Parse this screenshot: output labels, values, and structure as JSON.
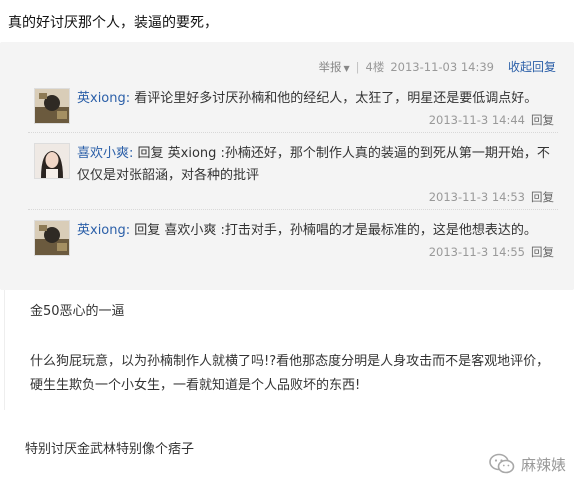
{
  "post": {
    "text": "真的好讨厌那个人，装逼的要死，"
  },
  "comment_meta": {
    "report_label": "举报",
    "floor": "4楼",
    "timestamp": "2013-11-03 14:39",
    "collapse_label": "收起回复"
  },
  "replies": [
    {
      "user": "英xiong:",
      "content": "看评论里好多讨厌孙楠和他的经纪人，太狂了，明星还是要低调点好。",
      "time": "2013-11-3 14:44",
      "reply_label": "回复",
      "avatar_icon": "avatar-dark-icon"
    },
    {
      "user": "喜欢小爽:",
      "content": "回复 英xiong :孙楠还好，那个制作人真的装逼的到死从第一期开始，不仅仅是对张韶涵，对各种的批评",
      "time": "2013-11-3 14:53",
      "reply_label": "回复",
      "avatar_icon": "avatar-girl-icon"
    },
    {
      "user": "英xiong:",
      "content": "回复 喜欢小爽 :打击对手，孙楠唱的才是最标准的，这是他想表达的。",
      "time": "2013-11-3 14:55",
      "reply_label": "回复",
      "avatar_icon": "avatar-dark-icon"
    }
  ],
  "other_comments": [
    "金50恶心的一逼",
    "什么狗屁玩意，以为孙楠制作人就横了吗!?看他那态度分明是人身攻击而不是客观地评价，硬生生欺负一个小女生，一看就知道是个人品败坏的东西!",
    "特别讨厌金武林特别像个痞子"
  ],
  "watermark": {
    "text": "麻辣婊",
    "icon": "wechat-icon"
  }
}
